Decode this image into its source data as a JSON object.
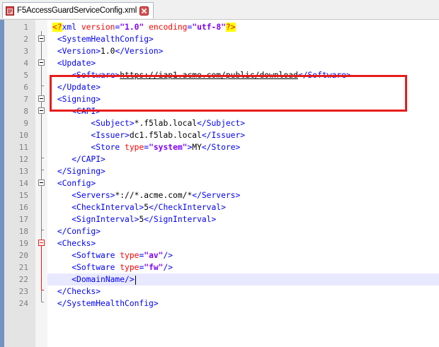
{
  "tab": {
    "label": "F5AccessGuardServiceConfig.xml"
  },
  "lines": [
    {
      "n": "1",
      "indent": "",
      "parts": [
        [
          "decl",
          "<?"
        ],
        [
          "tag",
          "xml "
        ],
        [
          "attr",
          "version"
        ],
        [
          "tag",
          "="
        ],
        [
          "val",
          "\"1.0\""
        ],
        [
          "tag",
          " "
        ],
        [
          "attr",
          "encoding"
        ],
        [
          "tag",
          "="
        ],
        [
          "val",
          "\"utf-8\""
        ],
        [
          "decl",
          "?>"
        ]
      ]
    },
    {
      "n": "2",
      "indent": " ",
      "parts": [
        [
          "tag",
          "<SystemHealthConfig>"
        ]
      ]
    },
    {
      "n": "3",
      "indent": " ",
      "parts": [
        [
          "tag",
          "<Version>"
        ],
        [
          "txt",
          "1.0"
        ],
        [
          "tag",
          "</Version>"
        ]
      ]
    },
    {
      "n": "4",
      "indent": " ",
      "parts": [
        [
          "tag",
          "<Update>"
        ]
      ]
    },
    {
      "n": "5",
      "indent": "    ",
      "parts": [
        [
          "tag",
          "<Software>"
        ],
        [
          "link",
          "https://iap1.acme.com/public/download"
        ],
        [
          "tag",
          "</Software>"
        ]
      ]
    },
    {
      "n": "6",
      "indent": " ",
      "parts": [
        [
          "tag",
          "</Update>"
        ]
      ]
    },
    {
      "n": "7",
      "indent": " ",
      "parts": [
        [
          "tag",
          "<Signing>"
        ]
      ]
    },
    {
      "n": "8",
      "indent": "    ",
      "parts": [
        [
          "tag",
          "<CAPI>"
        ]
      ]
    },
    {
      "n": "9",
      "indent": "        ",
      "parts": [
        [
          "tag",
          "<Subject>"
        ],
        [
          "txt",
          "*.f5lab.local"
        ],
        [
          "tag",
          "</Subject>"
        ]
      ]
    },
    {
      "n": "10",
      "indent": "        ",
      "parts": [
        [
          "tag",
          "<Issuer>"
        ],
        [
          "txt",
          "dc1.f5lab.local"
        ],
        [
          "tag",
          "</Issuer>"
        ]
      ]
    },
    {
      "n": "11",
      "indent": "        ",
      "parts": [
        [
          "tag",
          "<Store "
        ],
        [
          "attr",
          "type"
        ],
        [
          "tag",
          "="
        ],
        [
          "val",
          "\"system\""
        ],
        [
          "tag",
          ">"
        ],
        [
          "txt",
          "MY"
        ],
        [
          "tag",
          "</Store>"
        ]
      ]
    },
    {
      "n": "12",
      "indent": "    ",
      "parts": [
        [
          "tag",
          "</CAPI>"
        ]
      ]
    },
    {
      "n": "13",
      "indent": " ",
      "parts": [
        [
          "tag",
          "</Signing>"
        ]
      ]
    },
    {
      "n": "14",
      "indent": " ",
      "parts": [
        [
          "tag",
          "<Config>"
        ]
      ]
    },
    {
      "n": "15",
      "indent": "    ",
      "parts": [
        [
          "tag",
          "<Servers>"
        ],
        [
          "txt",
          "*://*.acme.com/*"
        ],
        [
          "tag",
          "</Servers>"
        ]
      ]
    },
    {
      "n": "16",
      "indent": "    ",
      "parts": [
        [
          "tag",
          "<CheckInterval>"
        ],
        [
          "txt",
          "5"
        ],
        [
          "tag",
          "</CheckInterval>"
        ]
      ]
    },
    {
      "n": "17",
      "indent": "    ",
      "parts": [
        [
          "tag",
          "<SignInterval>"
        ],
        [
          "txt",
          "5"
        ],
        [
          "tag",
          "</SignInterval>"
        ]
      ]
    },
    {
      "n": "18",
      "indent": " ",
      "parts": [
        [
          "tag",
          "</Config>"
        ]
      ]
    },
    {
      "n": "19",
      "indent": " ",
      "parts": [
        [
          "tag",
          "<Checks>"
        ]
      ]
    },
    {
      "n": "20",
      "indent": "    ",
      "parts": [
        [
          "tag",
          "<Software "
        ],
        [
          "attr",
          "type"
        ],
        [
          "tag",
          "="
        ],
        [
          "val",
          "\"av\""
        ],
        [
          "tag",
          "/>"
        ]
      ]
    },
    {
      "n": "21",
      "indent": "    ",
      "parts": [
        [
          "tag",
          "<Software "
        ],
        [
          "attr",
          "type"
        ],
        [
          "tag",
          "="
        ],
        [
          "val",
          "\"fw\""
        ],
        [
          "tag",
          "/>"
        ]
      ]
    },
    {
      "n": "22",
      "indent": "    ",
      "parts": [
        [
          "tag",
          "<DomainName/>"
        ]
      ]
    },
    {
      "n": "23",
      "indent": " ",
      "parts": [
        [
          "tag",
          "</Checks>"
        ]
      ]
    },
    {
      "n": "24",
      "indent": " ",
      "parts": [
        [
          "tag",
          "</SystemHealthConfig>"
        ]
      ]
    }
  ],
  "current_line": "22",
  "colors": {
    "tag": "#0000ff",
    "attr": "#ff0000",
    "value": "#8000ff",
    "highlight_box": "#e81c1c",
    "current_line": "#e8e8ff"
  },
  "icons": {
    "file": "notepad-file-icon",
    "close": "close-tab-icon"
  }
}
